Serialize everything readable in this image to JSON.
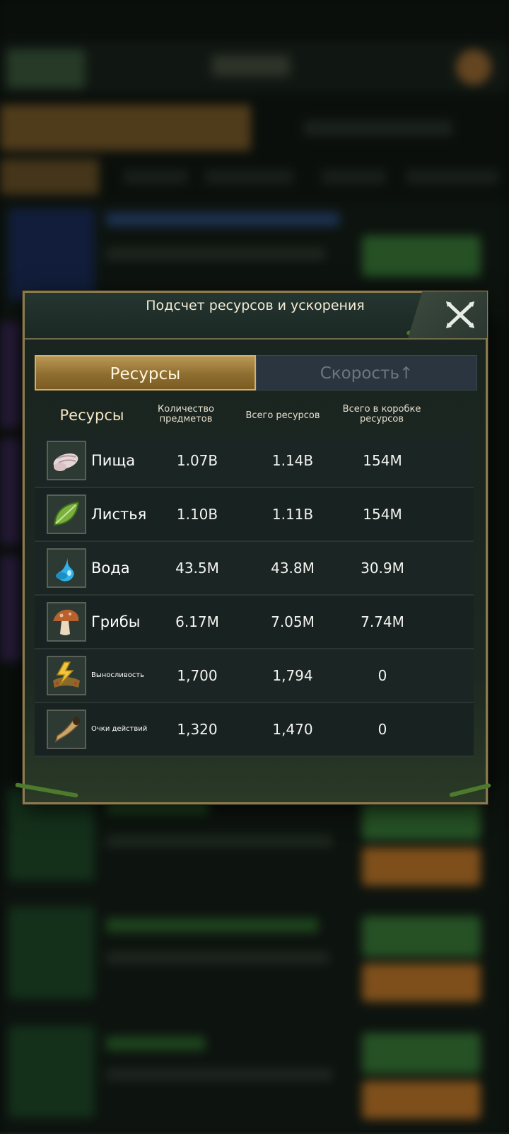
{
  "dialog": {
    "title": "Подсчет ресурсов и ускорения",
    "tabs": {
      "resources": "Ресурсы",
      "speed": "Скорость",
      "speed_arrow": "↑"
    }
  },
  "columns": {
    "resources": "Ресурсы",
    "items_count": "Количество предметов",
    "total": "Всего ресурсов",
    "in_box": "Всего в коробке ресурсов"
  },
  "rows": [
    {
      "name": "Пища",
      "icon": "food-grub-icon",
      "items": "1.07B",
      "total": "1.14B",
      "box": "154M"
    },
    {
      "name": "Листья",
      "icon": "leaf-icon",
      "items": "1.10B",
      "total": "1.11B",
      "box": "154M"
    },
    {
      "name": "Вода",
      "icon": "water-drop-icon",
      "items": "43.5M",
      "total": "43.8M",
      "box": "30.9M"
    },
    {
      "name": "Грибы",
      "icon": "mushroom-icon",
      "items": "6.17M",
      "total": "7.05M",
      "box": "7.74M"
    },
    {
      "name": "Выносливость",
      "icon": "stamina-icon",
      "items": "1,700",
      "total": "1,794",
      "box": "0"
    },
    {
      "name": "Очки действий",
      "icon": "action-horn-icon",
      "items": "1,320",
      "total": "1,470",
      "box": "0"
    }
  ]
}
